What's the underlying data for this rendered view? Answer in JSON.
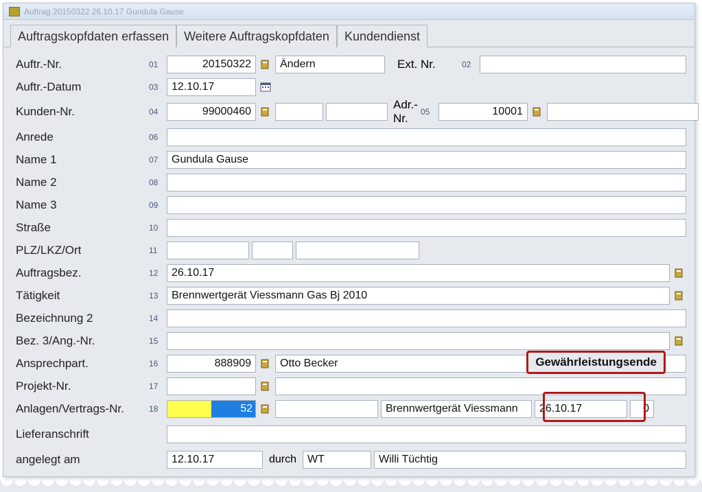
{
  "window": {
    "title": "Auftrag 20150322 26.10.17 Gundula Gause"
  },
  "tabs": {
    "t1": "Auftragskopfdaten erfassen",
    "t2": "Weitere Auftragskopfdaten",
    "t3": "Kundendienst"
  },
  "labels": {
    "auftr_nr": "Auftr.-Nr.",
    "ext_nr": "Ext. Nr.",
    "auftr_datum": "Auftr.-Datum",
    "kunden_nr": "Kunden-Nr.",
    "adr_nr": "Adr.-Nr.",
    "anrede": "Anrede",
    "name1": "Name 1",
    "name2": "Name 2",
    "name3": "Name 3",
    "strasse": "Straße",
    "plz": "PLZ/LKZ/Ort",
    "auftragsbez": "Auftragsbez.",
    "taetigkeit": "Tätigkeit",
    "bez2": "Bezeichnung 2",
    "bez3": "Bez. 3/Ang.-Nr.",
    "ansprech": "Ansprechpart.",
    "projekt": "Projekt-Nr.",
    "anlagen": "Anlagen/Vertrags-Nr.",
    "liefer": "Lieferanschrift",
    "angelegt": "angelegt am",
    "durch": "durch"
  },
  "nums": {
    "n01": "01",
    "n02": "02",
    "n03": "03",
    "n04": "04",
    "n05": "05",
    "n06": "06",
    "n07": "07",
    "n08": "08",
    "n09": "09",
    "n10": "10",
    "n11": "11",
    "n12": "12",
    "n13": "13",
    "n14": "14",
    "n15": "15",
    "n16": "16",
    "n17": "17",
    "n18": "18"
  },
  "values": {
    "auftr_nr": "20150322",
    "mode": "Ändern",
    "ext_nr": "",
    "auftr_datum": "12.10.17",
    "kunden_nr": "99000460",
    "kunden_extra1": "",
    "kunden_extra2": "",
    "adr_nr": "10001",
    "adr_extra": "",
    "anrede": "",
    "name1": "Gundula Gause",
    "name2": "",
    "name3": "",
    "strasse": "",
    "plz1": "",
    "plz2": "",
    "plz3": "",
    "auftragsbez": "26.10.17",
    "taetigkeit": "Brennwertgerät Viessmann Gas Bj 2010",
    "bez2": "",
    "bez3": "",
    "ansprech_nr": "888909",
    "ansprech_name": "Otto Becker",
    "projekt_nr": "",
    "projekt_name": "",
    "anlagen_nr": "52",
    "anlagen_extra": "",
    "anlagen_desc": "Brennwertgerät Viessmann",
    "anlagen_date": "26.10.17",
    "anlagen_zero": "0",
    "liefer": "",
    "angelegt_am": "12.10.17",
    "durch_code": "WT",
    "durch_name": "Willi Tüchtig"
  },
  "callout": "Gewährleistungsende"
}
